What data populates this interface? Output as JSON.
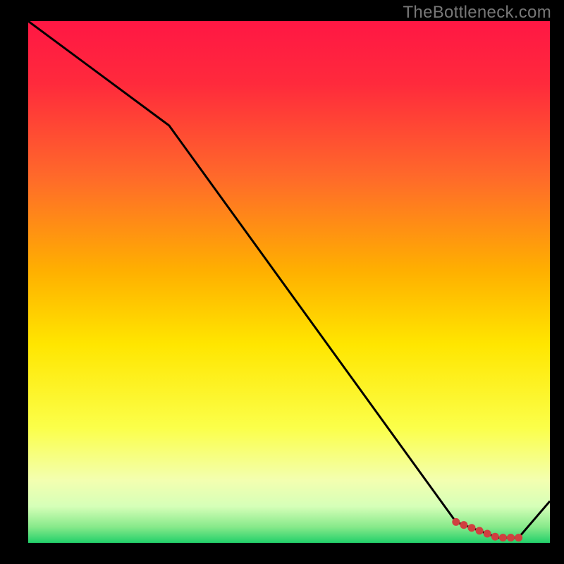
{
  "watermark": "TheBottleneck.com",
  "chart_data": {
    "type": "line",
    "title": "",
    "xlabel": "",
    "ylabel": "",
    "xlim": [
      0,
      100
    ],
    "ylim": [
      0,
      100
    ],
    "x": [
      0,
      27,
      82,
      90,
      94,
      100
    ],
    "values": [
      100,
      80,
      4,
      1,
      1,
      8
    ],
    "marker_range_x": [
      82,
      94
    ],
    "gradient_stops": [
      {
        "offset": 0,
        "color": "#ff1744"
      },
      {
        "offset": 12,
        "color": "#ff2a3c"
      },
      {
        "offset": 30,
        "color": "#ff6a2a"
      },
      {
        "offset": 48,
        "color": "#ffb000"
      },
      {
        "offset": 62,
        "color": "#ffe600"
      },
      {
        "offset": 78,
        "color": "#fbff4a"
      },
      {
        "offset": 88,
        "color": "#f3ffb0"
      },
      {
        "offset": 93,
        "color": "#d6ffb8"
      },
      {
        "offset": 97,
        "color": "#86e98a"
      },
      {
        "offset": 100,
        "color": "#22d06a"
      }
    ],
    "marker_color": "#d04040",
    "line_color": "#000000"
  }
}
